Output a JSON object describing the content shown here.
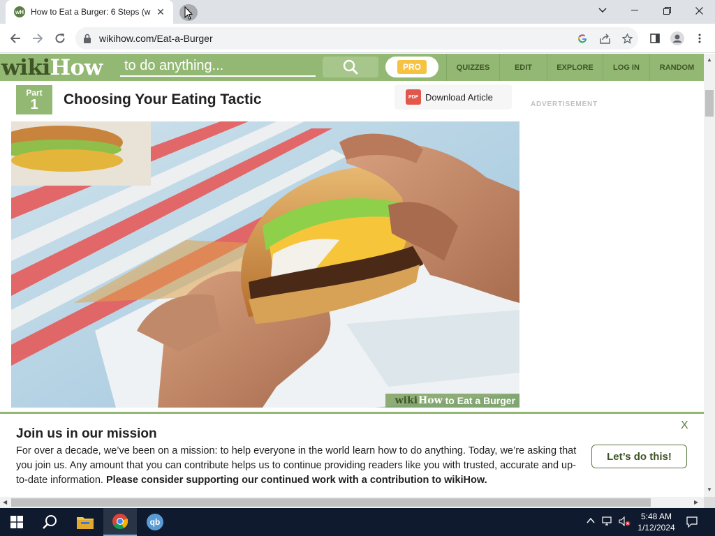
{
  "browser": {
    "tab_title": "How to Eat a Burger: 6 Steps (wi",
    "url": "wikihow.com/Eat-a-Burger"
  },
  "site": {
    "logo_wiki": "wiki",
    "logo_how": "How",
    "search_placeholder": "to do anything...",
    "pro_label": "PRO",
    "nav": [
      "QUIZZES",
      "EDIT",
      "EXPLORE",
      "LOG IN",
      "RANDOM"
    ],
    "brand_color": "#93b874"
  },
  "article": {
    "part_label": "Part",
    "part_number": "1",
    "section_title": "Choosing Your Eating Tactic",
    "download_label": "Download Article",
    "pdf_icon_text": "PDF",
    "watermark_wiki": "wiki",
    "watermark_how": "How",
    "watermark_rest": "to Eat a Burger"
  },
  "sidebar": {
    "ad_label": "ADVERTISEMENT"
  },
  "banner": {
    "title": "Join us in our mission",
    "body": "For over a decade, we’ve been on a mission: to help everyone in the world learn how to do anything. Today, we’re asking that you join us. Any amount that you can contribute helps us to continue providing readers like you with trusted, accurate and up-to-date information.",
    "body_bold": "Please consider supporting our continued work with a contribution to wikiHow.",
    "close_label": "X",
    "cta_label": "Let’s do this!"
  },
  "taskbar": {
    "time": "5:48 AM",
    "date": "1/12/2024",
    "qb_label": "qb"
  }
}
